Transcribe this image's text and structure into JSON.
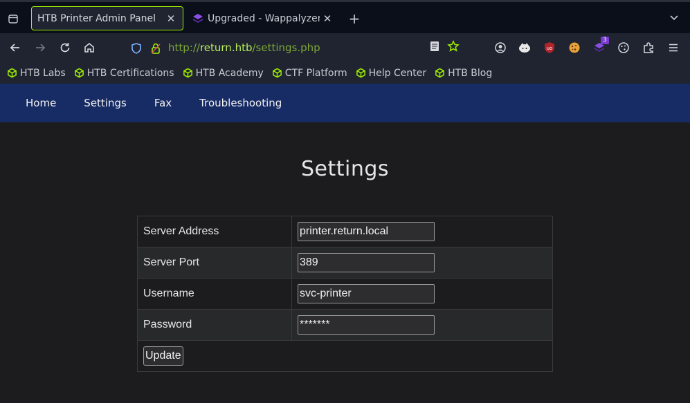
{
  "browser": {
    "tabs": [
      {
        "title": "HTB Printer Admin Panel",
        "active": true
      },
      {
        "title": "Upgraded - Wappalyzer",
        "active": false
      }
    ],
    "url": {
      "scheme": "http://",
      "host": "return.htb",
      "path": "/settings.php"
    },
    "extension_badge": "3",
    "accent_color": "#9fef00",
    "bookmarks": [
      {
        "label": "HTB Labs"
      },
      {
        "label": "HTB Certifications"
      },
      {
        "label": "HTB Academy"
      },
      {
        "label": "CTF Platform"
      },
      {
        "label": "Help Center"
      },
      {
        "label": "HTB Blog"
      }
    ]
  },
  "site_nav": [
    {
      "label": "Home"
    },
    {
      "label": "Settings"
    },
    {
      "label": "Fax"
    },
    {
      "label": "Troubleshooting"
    }
  ],
  "page": {
    "title": "Settings",
    "form": {
      "rows": [
        {
          "label": "Server Address",
          "value": "printer.return.local"
        },
        {
          "label": "Server Port",
          "value": "389"
        },
        {
          "label": "Username",
          "value": "svc-printer"
        },
        {
          "label": "Password",
          "value": "*******"
        }
      ],
      "submit_label": "Update"
    }
  }
}
